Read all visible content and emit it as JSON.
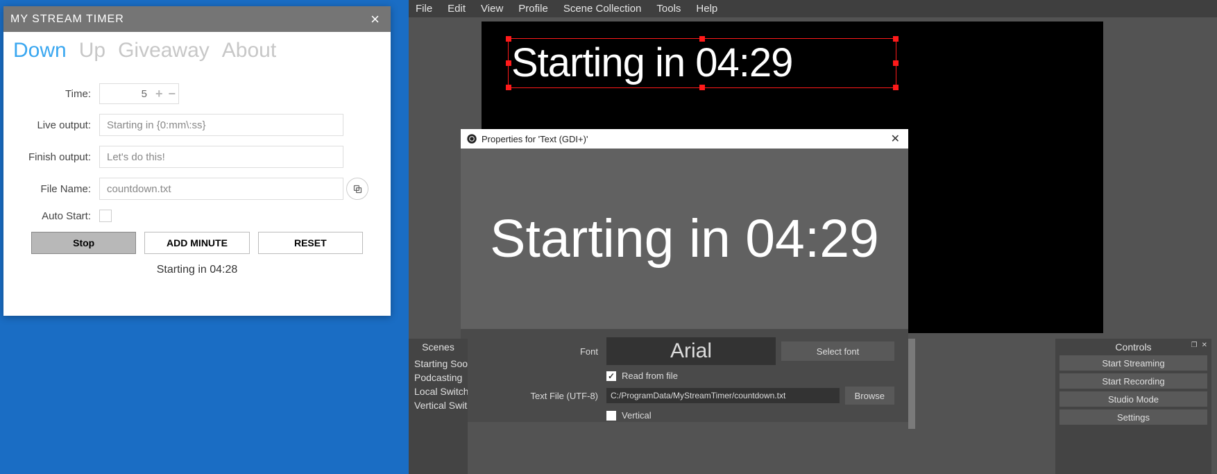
{
  "mst": {
    "title": "MY STREAM TIMER",
    "tabs": {
      "down": "Down",
      "up": "Up",
      "giveaway": "Giveaway",
      "about": "About"
    },
    "rows": {
      "time_label": "Time:",
      "time_value": "5",
      "live_label": "Live output:",
      "live_value": "Starting in {0:mm\\:ss}",
      "finish_label": "Finish output:",
      "finish_value": "Let's do this!",
      "file_label": "File Name:",
      "file_value": "countdown.txt",
      "auto_label": "Auto Start:"
    },
    "buttons": {
      "stop": "Stop",
      "add": "ADD MINUTE",
      "reset": "RESET"
    },
    "status": "Starting in 04:28"
  },
  "obs": {
    "menu": {
      "file": "File",
      "edit": "Edit",
      "view": "View",
      "profile": "Profile",
      "scene_collection": "Scene Collection",
      "tools": "Tools",
      "help": "Help"
    },
    "layer_text": "Starting in 04:29",
    "props": {
      "title": "Properties for 'Text (GDI+)'",
      "preview_text": "Starting in 04:29",
      "font_label": "Font",
      "font_value": "Arial",
      "select_font": "Select font",
      "read_label": "Read from file",
      "textfile_label": "Text File (UTF-8)",
      "textfile_value": "C:/ProgramData/MyStreamTimer/countdown.txt",
      "browse": "Browse",
      "vertical_label": "Vertical"
    },
    "scenes": {
      "header": "Scenes",
      "items": [
        "Starting Soo",
        "Podcasting",
        "Local Switch",
        "Vertical Swit"
      ]
    },
    "controls": {
      "header": "Controls",
      "start_stream": "Start Streaming",
      "start_record": "Start Recording",
      "studio": "Studio Mode",
      "settings": "Settings"
    }
  }
}
